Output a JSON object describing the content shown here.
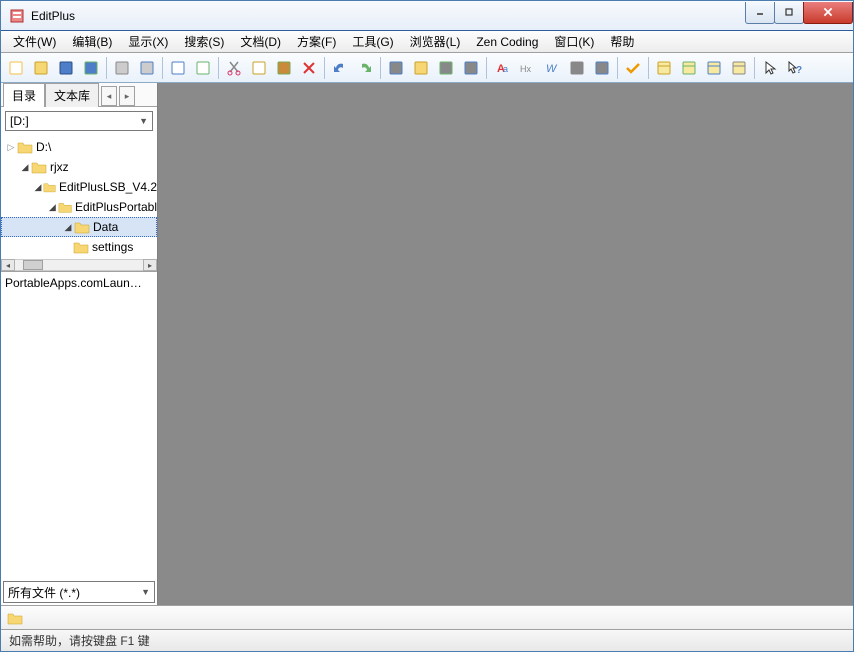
{
  "title": "EditPlus",
  "menu": [
    "文件(W)",
    "编辑(B)",
    "显示(X)",
    "搜索(S)",
    "文档(D)",
    "方案(F)",
    "工具(G)",
    "浏览器(L)",
    "Zen Coding",
    "窗口(K)",
    "帮助"
  ],
  "toolbar_icons": [
    "new-file",
    "open-file",
    "save",
    "save-all",
    "|",
    "print",
    "print-preview",
    "|",
    "browser-launch",
    "browser-edit",
    "|",
    "cut",
    "copy",
    "paste",
    "delete",
    "|",
    "undo",
    "redo",
    "|",
    "find",
    "find-highlight",
    "replace",
    "goto",
    "|",
    "font",
    "hex",
    "wordwrap",
    "invisible",
    "linenum",
    "|",
    "check",
    "|",
    "window-type1",
    "window-type2",
    "window-type3",
    "window-type4",
    "|",
    "pointer",
    "help-context"
  ],
  "sidebar": {
    "tabs": {
      "active": "目录",
      "inactive": "文本库"
    },
    "drive": "[D:]",
    "tree": [
      {
        "label": "D:\\",
        "indent": 1,
        "open": false
      },
      {
        "label": "rjxz",
        "indent": 2,
        "open": true
      },
      {
        "label": "EditPlusLSB_V4.2",
        "indent": 3,
        "open": true
      },
      {
        "label": "EditPlusPortabl",
        "indent": 4,
        "open": true
      },
      {
        "label": "Data",
        "indent": 5,
        "open": true,
        "selected": true
      },
      {
        "label": "settings",
        "indent": 5,
        "open": false,
        "leaf": true
      }
    ],
    "filelist_item": "PortableApps.comLaun…",
    "filter": "所有文件 (*.*)"
  },
  "status": "如需帮助，请按键盘 F1 键"
}
